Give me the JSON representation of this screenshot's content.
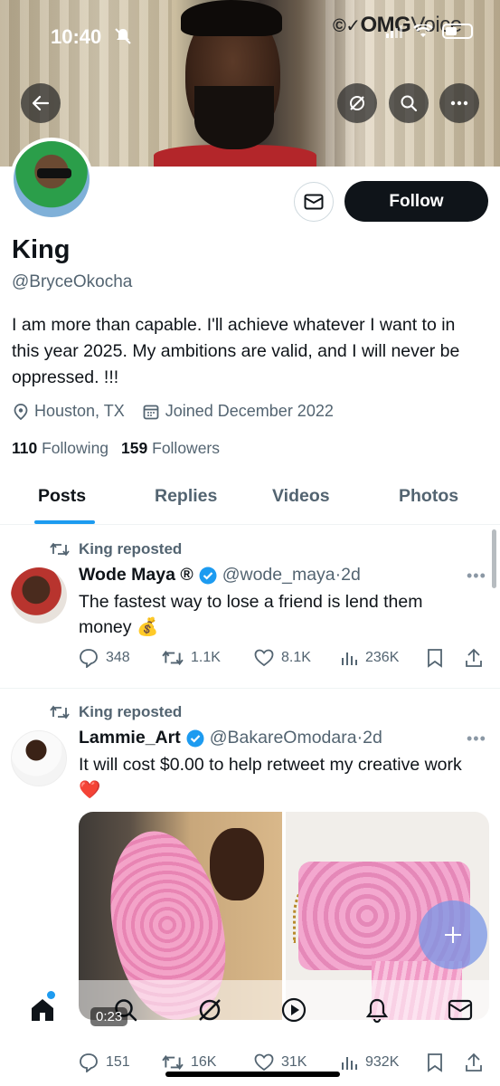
{
  "status_bar": {
    "time": "10:40"
  },
  "watermark": {
    "brand_a": "OMG",
    "brand_b": "Voice"
  },
  "profile": {
    "name": "King",
    "handle": "@BryceOkocha",
    "bio": "I am more than capable. I'll achieve whatever I want to in this year 2025. My ambitions are valid, and I will never be oppressed. !!!",
    "location": "Houston, TX",
    "joined": "Joined December 2022",
    "following_count": "110",
    "following_label": "Following",
    "followers_count": "159",
    "followers_label": "Followers",
    "follow_label": "Follow"
  },
  "tabs": [
    {
      "label": "Posts",
      "active": true
    },
    {
      "label": "Replies",
      "active": false
    },
    {
      "label": "Videos",
      "active": false
    },
    {
      "label": "Photos",
      "active": false
    }
  ],
  "posts": [
    {
      "repost_label": "King reposted",
      "author": "Wode Maya ®",
      "handle": "@wode_maya",
      "time": "2d",
      "text": "The fastest way to lose a friend is lend them money 💰",
      "replies": "348",
      "reposts": "1.1K",
      "likes": "8.1K",
      "views": "236K"
    },
    {
      "repost_label": "King reposted",
      "author": "Lammie_Art",
      "handle": "@BakareOmodara",
      "time": "2d",
      "text": "It will cost $0.00 to help retweet my creative work ❤️",
      "video_time": "0:23",
      "replies": "151",
      "reposts": "16K",
      "likes": "31K",
      "views": "932K"
    }
  ],
  "colors": {
    "accent": "#1d9bf0",
    "text": "#0f1419",
    "muted": "#536471"
  }
}
